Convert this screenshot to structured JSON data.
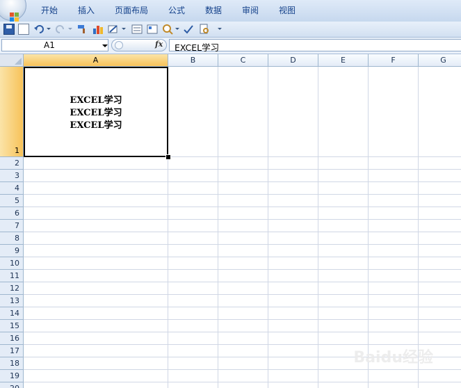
{
  "ribbon": {
    "tabs": [
      "开始",
      "插入",
      "页面布局",
      "公式",
      "数据",
      "审阅",
      "视图"
    ]
  },
  "quick_access": {
    "icons": [
      "save-icon",
      "new-icon",
      "undo-icon",
      "redo-icon",
      "format-painter-icon",
      "chart-icon",
      "draw-icon",
      "form-icon",
      "properties-icon",
      "zoom-icon",
      "spelling-icon",
      "print-preview-icon",
      "customize-icon"
    ]
  },
  "formula_bar": {
    "name_box": "A1",
    "fx_label": "fx",
    "formula_value": "EXCEL学习"
  },
  "sheet": {
    "columns": [
      "A",
      "B",
      "C",
      "D",
      "E",
      "F",
      "G"
    ],
    "selected_column": "A",
    "rows": [
      "1",
      "2",
      "3",
      "4",
      "5",
      "6",
      "7",
      "8",
      "9",
      "10",
      "11",
      "12",
      "13",
      "14",
      "15",
      "16",
      "17",
      "18",
      "19",
      "20"
    ],
    "selected_row": "1",
    "cells": {
      "A1": "EXCEL学习\nEXCEL学习\nEXCEL学习"
    }
  },
  "colors": {
    "header_selected": "#f7c259",
    "ribbon_text": "#15428b",
    "gridline": "#d0d7e5"
  }
}
